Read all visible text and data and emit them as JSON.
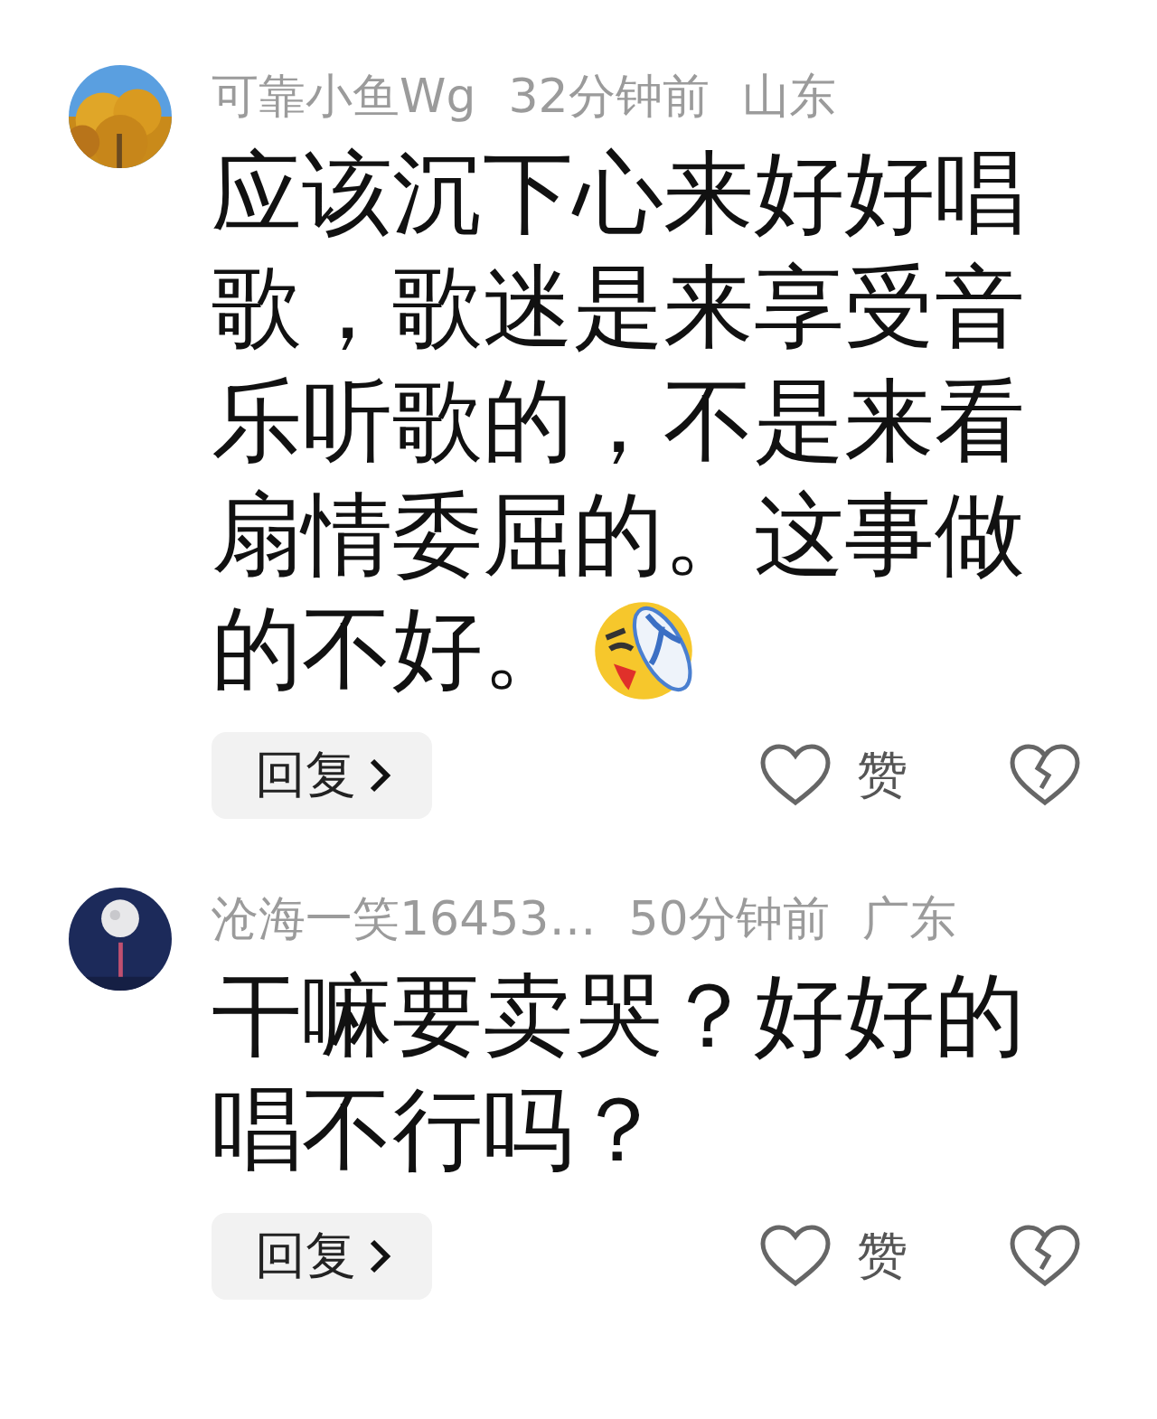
{
  "comments": [
    {
      "username": "可靠小鱼Wg",
      "time": "32分钟前",
      "location": "山东",
      "text": "应该沉下心来好好唱歌，歌迷是来享受音乐听歌的，不是来看扇情委屈的。这事做的不好。",
      "sticker": true,
      "reply_label": "回复",
      "like_label": "赞",
      "liked": false
    },
    {
      "username": "沧海一笑16453…",
      "time": "50分钟前",
      "location": "广东",
      "text": "干嘛要卖哭？好好的唱不行吗？",
      "sticker": false,
      "reply_label": "回复",
      "like_label": "赞",
      "liked": false
    }
  ]
}
